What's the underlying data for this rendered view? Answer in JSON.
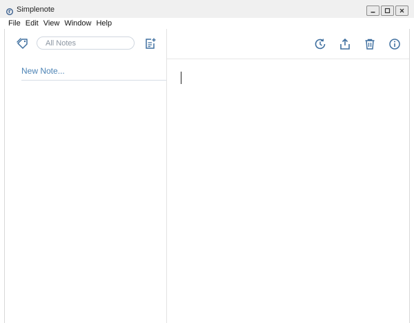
{
  "window": {
    "title": "Simplenote",
    "controls": [
      "minimize",
      "maximize",
      "close"
    ]
  },
  "menu": {
    "items": [
      "File",
      "Edit",
      "View",
      "Window",
      "Help"
    ]
  },
  "sidebar": {
    "search_placeholder": "All Notes",
    "notes": [
      {
        "title": "New Note..."
      }
    ]
  },
  "toolbar": {
    "icons": [
      "tag-icon",
      "new-note-icon",
      "history-icon",
      "share-icon",
      "trash-icon",
      "info-icon"
    ]
  },
  "colors": {
    "accent": "#3f6f9f",
    "note_title": "#4c83b5",
    "divider": "#e2e2e2"
  }
}
